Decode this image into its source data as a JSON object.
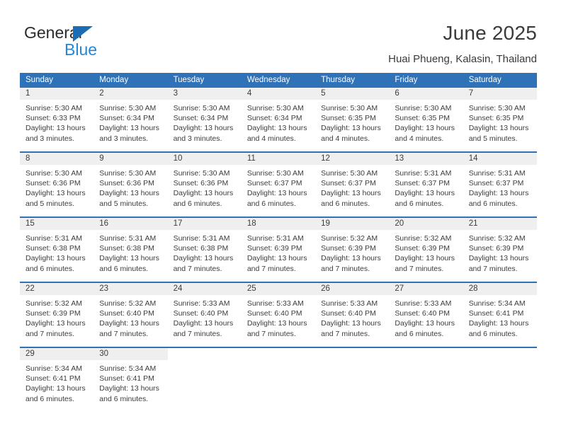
{
  "brand": {
    "name_primary": "General",
    "name_secondary": "Blue",
    "triangle_icon": "blue-triangle-icon",
    "color_primary": "#2b2b2b",
    "color_secondary": "#2387d8"
  },
  "header": {
    "title": "June 2025",
    "subtitle": "Huai Phueng, Kalasin, Thailand"
  },
  "theme": {
    "header_blue": "#2f72b8",
    "day_band_gray": "#efefef",
    "text": "#3c3c3c"
  },
  "calendar": {
    "weekday_headers": [
      "Sunday",
      "Monday",
      "Tuesday",
      "Wednesday",
      "Thursday",
      "Friday",
      "Saturday"
    ],
    "weeks": [
      [
        {
          "day": "1",
          "sunrise": "Sunrise: 5:30 AM",
          "sunset": "Sunset: 6:33 PM",
          "daylight_1": "Daylight: 13 hours",
          "daylight_2": "and 3 minutes."
        },
        {
          "day": "2",
          "sunrise": "Sunrise: 5:30 AM",
          "sunset": "Sunset: 6:34 PM",
          "daylight_1": "Daylight: 13 hours",
          "daylight_2": "and 3 minutes."
        },
        {
          "day": "3",
          "sunrise": "Sunrise: 5:30 AM",
          "sunset": "Sunset: 6:34 PM",
          "daylight_1": "Daylight: 13 hours",
          "daylight_2": "and 3 minutes."
        },
        {
          "day": "4",
          "sunrise": "Sunrise: 5:30 AM",
          "sunset": "Sunset: 6:34 PM",
          "daylight_1": "Daylight: 13 hours",
          "daylight_2": "and 4 minutes."
        },
        {
          "day": "5",
          "sunrise": "Sunrise: 5:30 AM",
          "sunset": "Sunset: 6:35 PM",
          "daylight_1": "Daylight: 13 hours",
          "daylight_2": "and 4 minutes."
        },
        {
          "day": "6",
          "sunrise": "Sunrise: 5:30 AM",
          "sunset": "Sunset: 6:35 PM",
          "daylight_1": "Daylight: 13 hours",
          "daylight_2": "and 4 minutes."
        },
        {
          "day": "7",
          "sunrise": "Sunrise: 5:30 AM",
          "sunset": "Sunset: 6:35 PM",
          "daylight_1": "Daylight: 13 hours",
          "daylight_2": "and 5 minutes."
        }
      ],
      [
        {
          "day": "8",
          "sunrise": "Sunrise: 5:30 AM",
          "sunset": "Sunset: 6:36 PM",
          "daylight_1": "Daylight: 13 hours",
          "daylight_2": "and 5 minutes."
        },
        {
          "day": "9",
          "sunrise": "Sunrise: 5:30 AM",
          "sunset": "Sunset: 6:36 PM",
          "daylight_1": "Daylight: 13 hours",
          "daylight_2": "and 5 minutes."
        },
        {
          "day": "10",
          "sunrise": "Sunrise: 5:30 AM",
          "sunset": "Sunset: 6:36 PM",
          "daylight_1": "Daylight: 13 hours",
          "daylight_2": "and 6 minutes."
        },
        {
          "day": "11",
          "sunrise": "Sunrise: 5:30 AM",
          "sunset": "Sunset: 6:37 PM",
          "daylight_1": "Daylight: 13 hours",
          "daylight_2": "and 6 minutes."
        },
        {
          "day": "12",
          "sunrise": "Sunrise: 5:30 AM",
          "sunset": "Sunset: 6:37 PM",
          "daylight_1": "Daylight: 13 hours",
          "daylight_2": "and 6 minutes."
        },
        {
          "day": "13",
          "sunrise": "Sunrise: 5:31 AM",
          "sunset": "Sunset: 6:37 PM",
          "daylight_1": "Daylight: 13 hours",
          "daylight_2": "and 6 minutes."
        },
        {
          "day": "14",
          "sunrise": "Sunrise: 5:31 AM",
          "sunset": "Sunset: 6:37 PM",
          "daylight_1": "Daylight: 13 hours",
          "daylight_2": "and 6 minutes."
        }
      ],
      [
        {
          "day": "15",
          "sunrise": "Sunrise: 5:31 AM",
          "sunset": "Sunset: 6:38 PM",
          "daylight_1": "Daylight: 13 hours",
          "daylight_2": "and 6 minutes."
        },
        {
          "day": "16",
          "sunrise": "Sunrise: 5:31 AM",
          "sunset": "Sunset: 6:38 PM",
          "daylight_1": "Daylight: 13 hours",
          "daylight_2": "and 6 minutes."
        },
        {
          "day": "17",
          "sunrise": "Sunrise: 5:31 AM",
          "sunset": "Sunset: 6:38 PM",
          "daylight_1": "Daylight: 13 hours",
          "daylight_2": "and 7 minutes."
        },
        {
          "day": "18",
          "sunrise": "Sunrise: 5:31 AM",
          "sunset": "Sunset: 6:39 PM",
          "daylight_1": "Daylight: 13 hours",
          "daylight_2": "and 7 minutes."
        },
        {
          "day": "19",
          "sunrise": "Sunrise: 5:32 AM",
          "sunset": "Sunset: 6:39 PM",
          "daylight_1": "Daylight: 13 hours",
          "daylight_2": "and 7 minutes."
        },
        {
          "day": "20",
          "sunrise": "Sunrise: 5:32 AM",
          "sunset": "Sunset: 6:39 PM",
          "daylight_1": "Daylight: 13 hours",
          "daylight_2": "and 7 minutes."
        },
        {
          "day": "21",
          "sunrise": "Sunrise: 5:32 AM",
          "sunset": "Sunset: 6:39 PM",
          "daylight_1": "Daylight: 13 hours",
          "daylight_2": "and 7 minutes."
        }
      ],
      [
        {
          "day": "22",
          "sunrise": "Sunrise: 5:32 AM",
          "sunset": "Sunset: 6:39 PM",
          "daylight_1": "Daylight: 13 hours",
          "daylight_2": "and 7 minutes."
        },
        {
          "day": "23",
          "sunrise": "Sunrise: 5:32 AM",
          "sunset": "Sunset: 6:40 PM",
          "daylight_1": "Daylight: 13 hours",
          "daylight_2": "and 7 minutes."
        },
        {
          "day": "24",
          "sunrise": "Sunrise: 5:33 AM",
          "sunset": "Sunset: 6:40 PM",
          "daylight_1": "Daylight: 13 hours",
          "daylight_2": "and 7 minutes."
        },
        {
          "day": "25",
          "sunrise": "Sunrise: 5:33 AM",
          "sunset": "Sunset: 6:40 PM",
          "daylight_1": "Daylight: 13 hours",
          "daylight_2": "and 7 minutes."
        },
        {
          "day": "26",
          "sunrise": "Sunrise: 5:33 AM",
          "sunset": "Sunset: 6:40 PM",
          "daylight_1": "Daylight: 13 hours",
          "daylight_2": "and 7 minutes."
        },
        {
          "day": "27",
          "sunrise": "Sunrise: 5:33 AM",
          "sunset": "Sunset: 6:40 PM",
          "daylight_1": "Daylight: 13 hours",
          "daylight_2": "and 6 minutes."
        },
        {
          "day": "28",
          "sunrise": "Sunrise: 5:34 AM",
          "sunset": "Sunset: 6:41 PM",
          "daylight_1": "Daylight: 13 hours",
          "daylight_2": "and 6 minutes."
        }
      ],
      [
        {
          "day": "29",
          "sunrise": "Sunrise: 5:34 AM",
          "sunset": "Sunset: 6:41 PM",
          "daylight_1": "Daylight: 13 hours",
          "daylight_2": "and 6 minutes."
        },
        {
          "day": "30",
          "sunrise": "Sunrise: 5:34 AM",
          "sunset": "Sunset: 6:41 PM",
          "daylight_1": "Daylight: 13 hours",
          "daylight_2": "and 6 minutes."
        },
        {
          "day": "",
          "sunrise": "",
          "sunset": "",
          "daylight_1": "",
          "daylight_2": ""
        },
        {
          "day": "",
          "sunrise": "",
          "sunset": "",
          "daylight_1": "",
          "daylight_2": ""
        },
        {
          "day": "",
          "sunrise": "",
          "sunset": "",
          "daylight_1": "",
          "daylight_2": ""
        },
        {
          "day": "",
          "sunrise": "",
          "sunset": "",
          "daylight_1": "",
          "daylight_2": ""
        },
        {
          "day": "",
          "sunrise": "",
          "sunset": "",
          "daylight_1": "",
          "daylight_2": ""
        }
      ]
    ]
  }
}
